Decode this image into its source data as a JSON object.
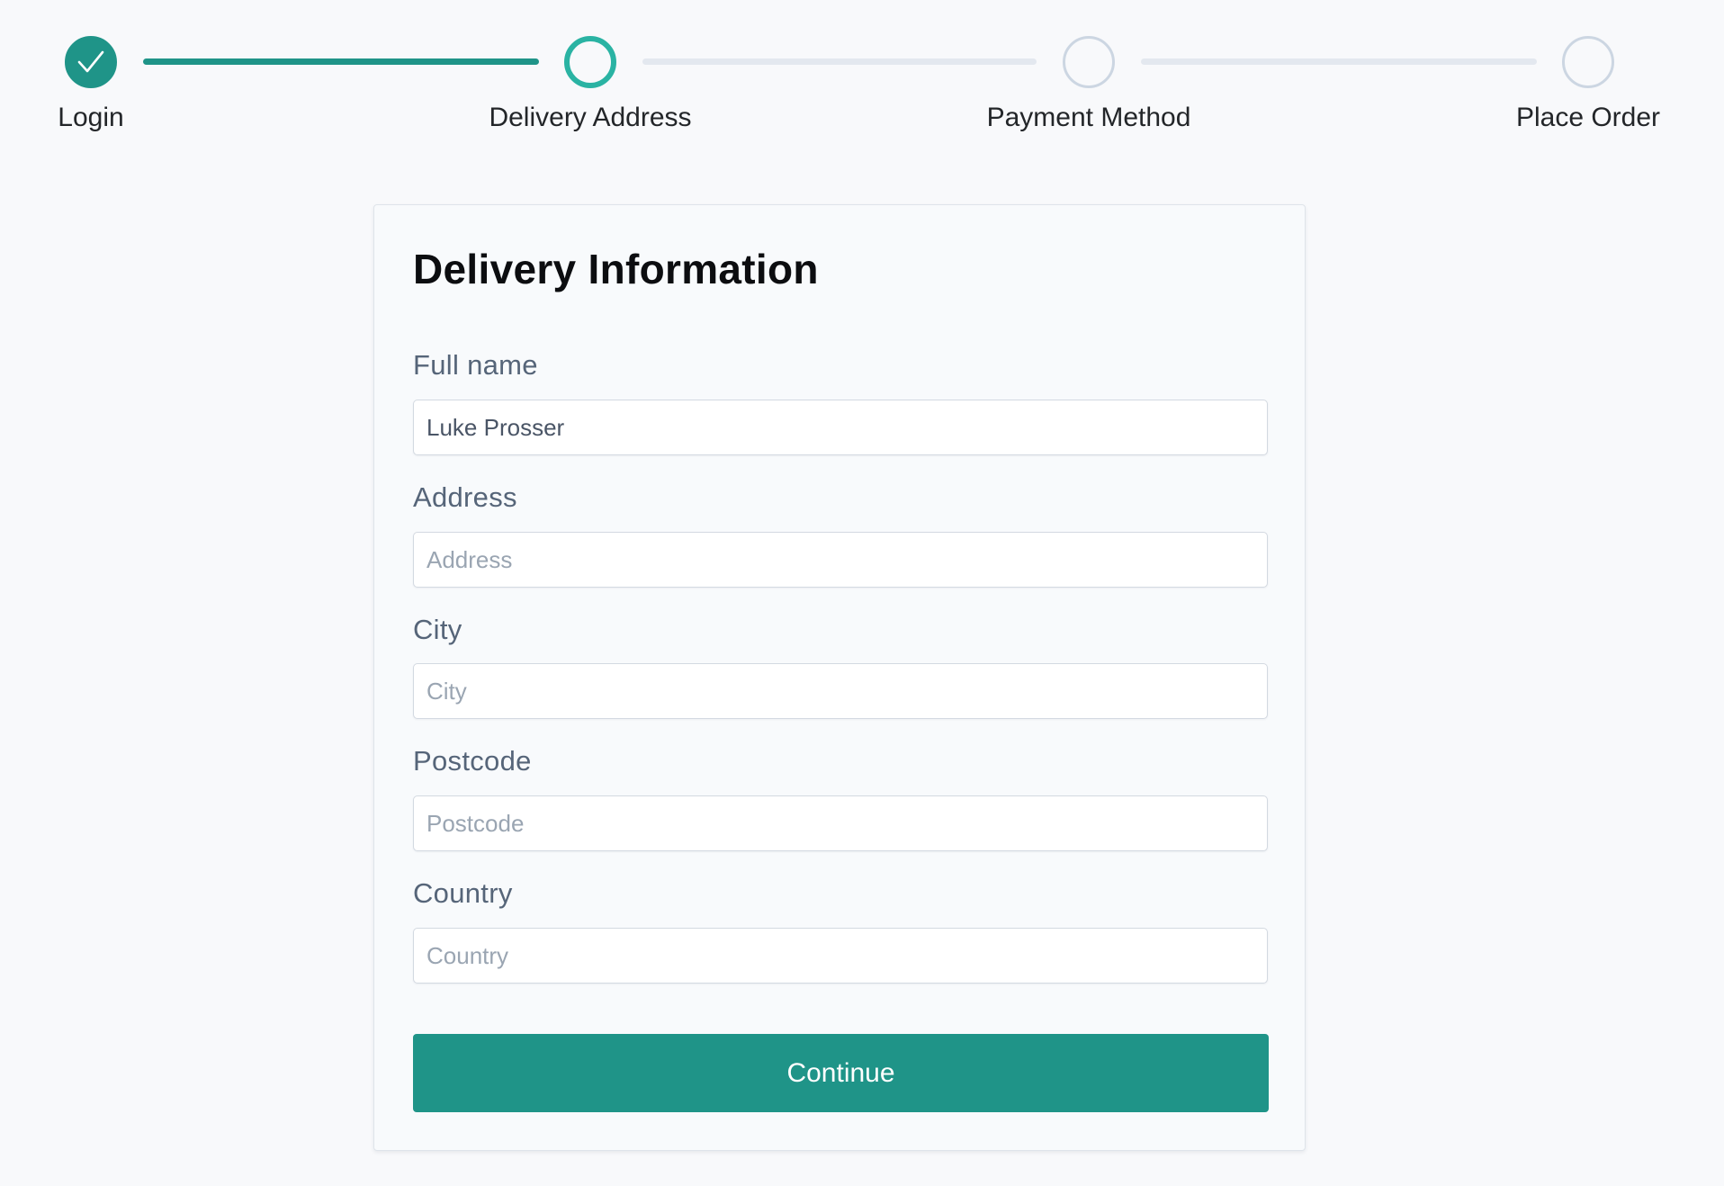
{
  "stepper": {
    "steps": [
      {
        "label": "Login",
        "state": "done"
      },
      {
        "label": "Delivery Address",
        "state": "current"
      },
      {
        "label": "Payment Method",
        "state": "todo"
      },
      {
        "label": "Place Order",
        "state": "todo"
      }
    ],
    "done_icon": "checkmark-icon"
  },
  "form": {
    "title": "Delivery Information",
    "fields": [
      {
        "label": "Full name",
        "value": "Luke Prosser",
        "placeholder": ""
      },
      {
        "label": "Address",
        "value": "",
        "placeholder": "Address"
      },
      {
        "label": "City",
        "value": "",
        "placeholder": "City"
      },
      {
        "label": "Postcode",
        "value": "",
        "placeholder": "Postcode"
      },
      {
        "label": "Country",
        "value": "",
        "placeholder": "Country"
      }
    ],
    "submit_label": "Continue"
  },
  "colors": {
    "accent": "#1f9488",
    "accent_current": "#2ab3a3",
    "inactive": "#ccd6e2",
    "background": "#f8f9fb",
    "label": "#566579"
  }
}
